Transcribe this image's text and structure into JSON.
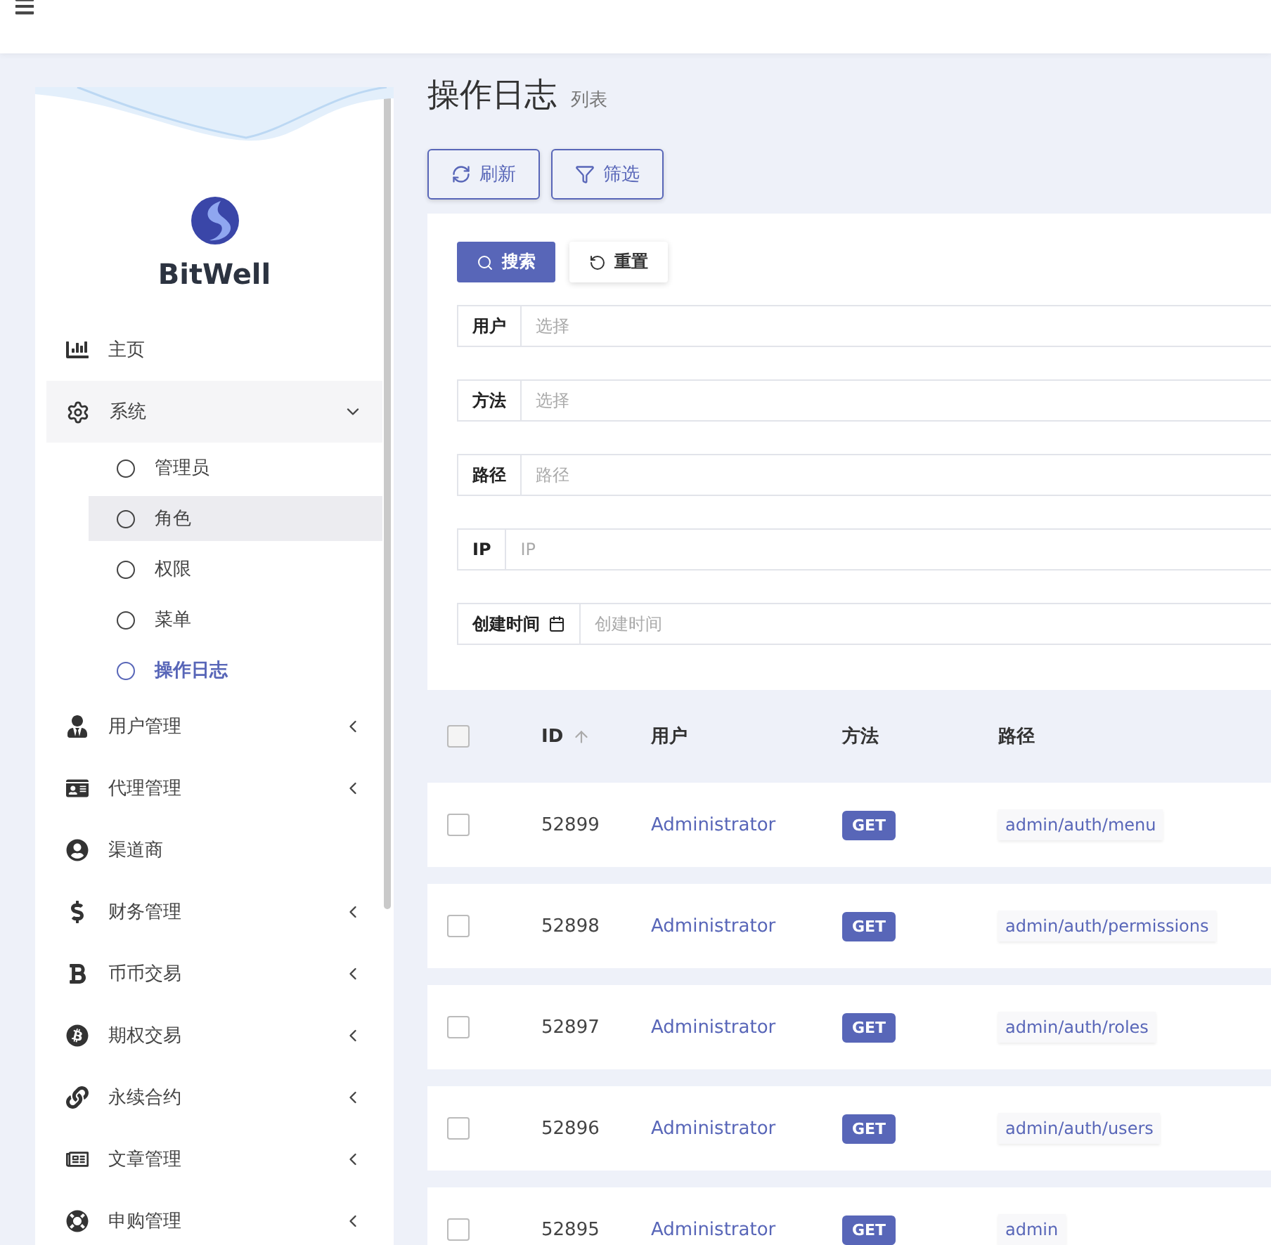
{
  "brand": "BitWell",
  "sidebar": {
    "items": [
      {
        "kind": "link",
        "label": "主页"
      },
      {
        "kind": "group",
        "label": "系统",
        "expanded": true,
        "children": [
          {
            "label": "管理员",
            "selected": false,
            "hovered": false
          },
          {
            "label": "角色",
            "selected": false,
            "hovered": true
          },
          {
            "label": "权限",
            "selected": false,
            "hovered": false
          },
          {
            "label": "菜单",
            "selected": false,
            "hovered": false
          },
          {
            "label": "操作日志",
            "selected": true,
            "hovered": false
          }
        ]
      },
      {
        "kind": "group",
        "label": "用户管理",
        "expanded": false
      },
      {
        "kind": "group",
        "label": "代理管理",
        "expanded": false
      },
      {
        "kind": "link",
        "label": "渠道商"
      },
      {
        "kind": "group",
        "label": "财务管理",
        "expanded": false
      },
      {
        "kind": "group",
        "label": "币币交易",
        "expanded": false
      },
      {
        "kind": "group",
        "label": "期权交易",
        "expanded": false
      },
      {
        "kind": "group",
        "label": "永续合约",
        "expanded": false
      },
      {
        "kind": "group",
        "label": "文章管理",
        "expanded": false
      },
      {
        "kind": "group",
        "label": "申购管理",
        "expanded": false
      }
    ]
  },
  "page": {
    "title": "操作日志",
    "subtitle": "列表"
  },
  "toolbar": [
    {
      "kind": "refresh",
      "label": "刷新"
    },
    {
      "kind": "filter",
      "label": "筛选"
    }
  ],
  "filter": {
    "search_button": "搜索",
    "reset_button": "重置",
    "fields": [
      {
        "label": "用户",
        "placeholder": "选择",
        "kind": "select"
      },
      {
        "label": "方法",
        "placeholder": "选择",
        "kind": "select"
      },
      {
        "label": "路径",
        "placeholder": "路径",
        "kind": "text"
      },
      {
        "label": "IP",
        "placeholder": "IP",
        "kind": "text"
      },
      {
        "label": "创建时间",
        "placeholder": "创建时间",
        "kind": "date"
      }
    ]
  },
  "table": {
    "all_checked": false,
    "columns": [
      "ID",
      "用户",
      "方法",
      "路径"
    ],
    "rows": [
      {
        "id": "52899",
        "user": "Administrator",
        "method": "GET",
        "path": "admin/auth/menu",
        "checked": false
      },
      {
        "id": "52898",
        "user": "Administrator",
        "method": "GET",
        "path": "admin/auth/permissions",
        "checked": false
      },
      {
        "id": "52897",
        "user": "Administrator",
        "method": "GET",
        "path": "admin/auth/roles",
        "checked": false
      },
      {
        "id": "52896",
        "user": "Administrator",
        "method": "GET",
        "path": "admin/auth/users",
        "checked": false
      },
      {
        "id": "52895",
        "user": "Administrator",
        "method": "GET",
        "path": "admin",
        "checked": false
      }
    ]
  }
}
